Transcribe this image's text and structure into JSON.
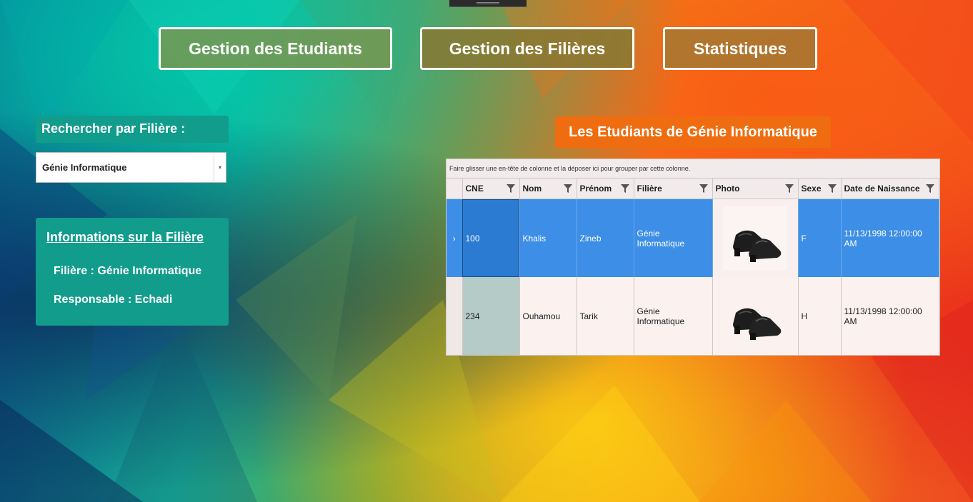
{
  "nav": {
    "etudiants": "Gestion des Etudiants",
    "filieres": "Gestion des Filières",
    "statistiques": "Statistiques"
  },
  "search": {
    "label": "Rechercher par Filière :",
    "selected": "Génie Informatique"
  },
  "info": {
    "title": "Informations sur la Filière",
    "filiere": "Filière : Génie Informatique",
    "responsable": "Responsable : Echadi"
  },
  "grid": {
    "title": "Les Etudiants de Génie Informatique",
    "group_hint": "Faire glisser une en-tête de colonne et la déposer ici pour grouper par cette colonne.",
    "columns": [
      "CNE",
      "Nom",
      "Prénom",
      "Filière",
      "Photo",
      "Sexe",
      "Date de Naissance"
    ],
    "rows": [
      {
        "cne": "100",
        "nom": "Khalis",
        "prenom": "Zineb",
        "filiere": "Génie Informatique",
        "photo": "shoes-photo",
        "sexe": "F",
        "date": "11/13/1998 12:00:00 AM",
        "selected": true
      },
      {
        "cne": "234",
        "nom": "Ouhamou",
        "prenom": "Tarik",
        "filiere": "Génie Informatique",
        "photo": "shoes-photo",
        "sexe": "H",
        "date": "11/13/1998 12:00:00 AM",
        "selected": false
      }
    ],
    "row_indicator": "›"
  },
  "colors": {
    "teal_panel": "#119c8c",
    "orange_title": "#ef6d10",
    "selected_row": "#3d8ee6"
  }
}
